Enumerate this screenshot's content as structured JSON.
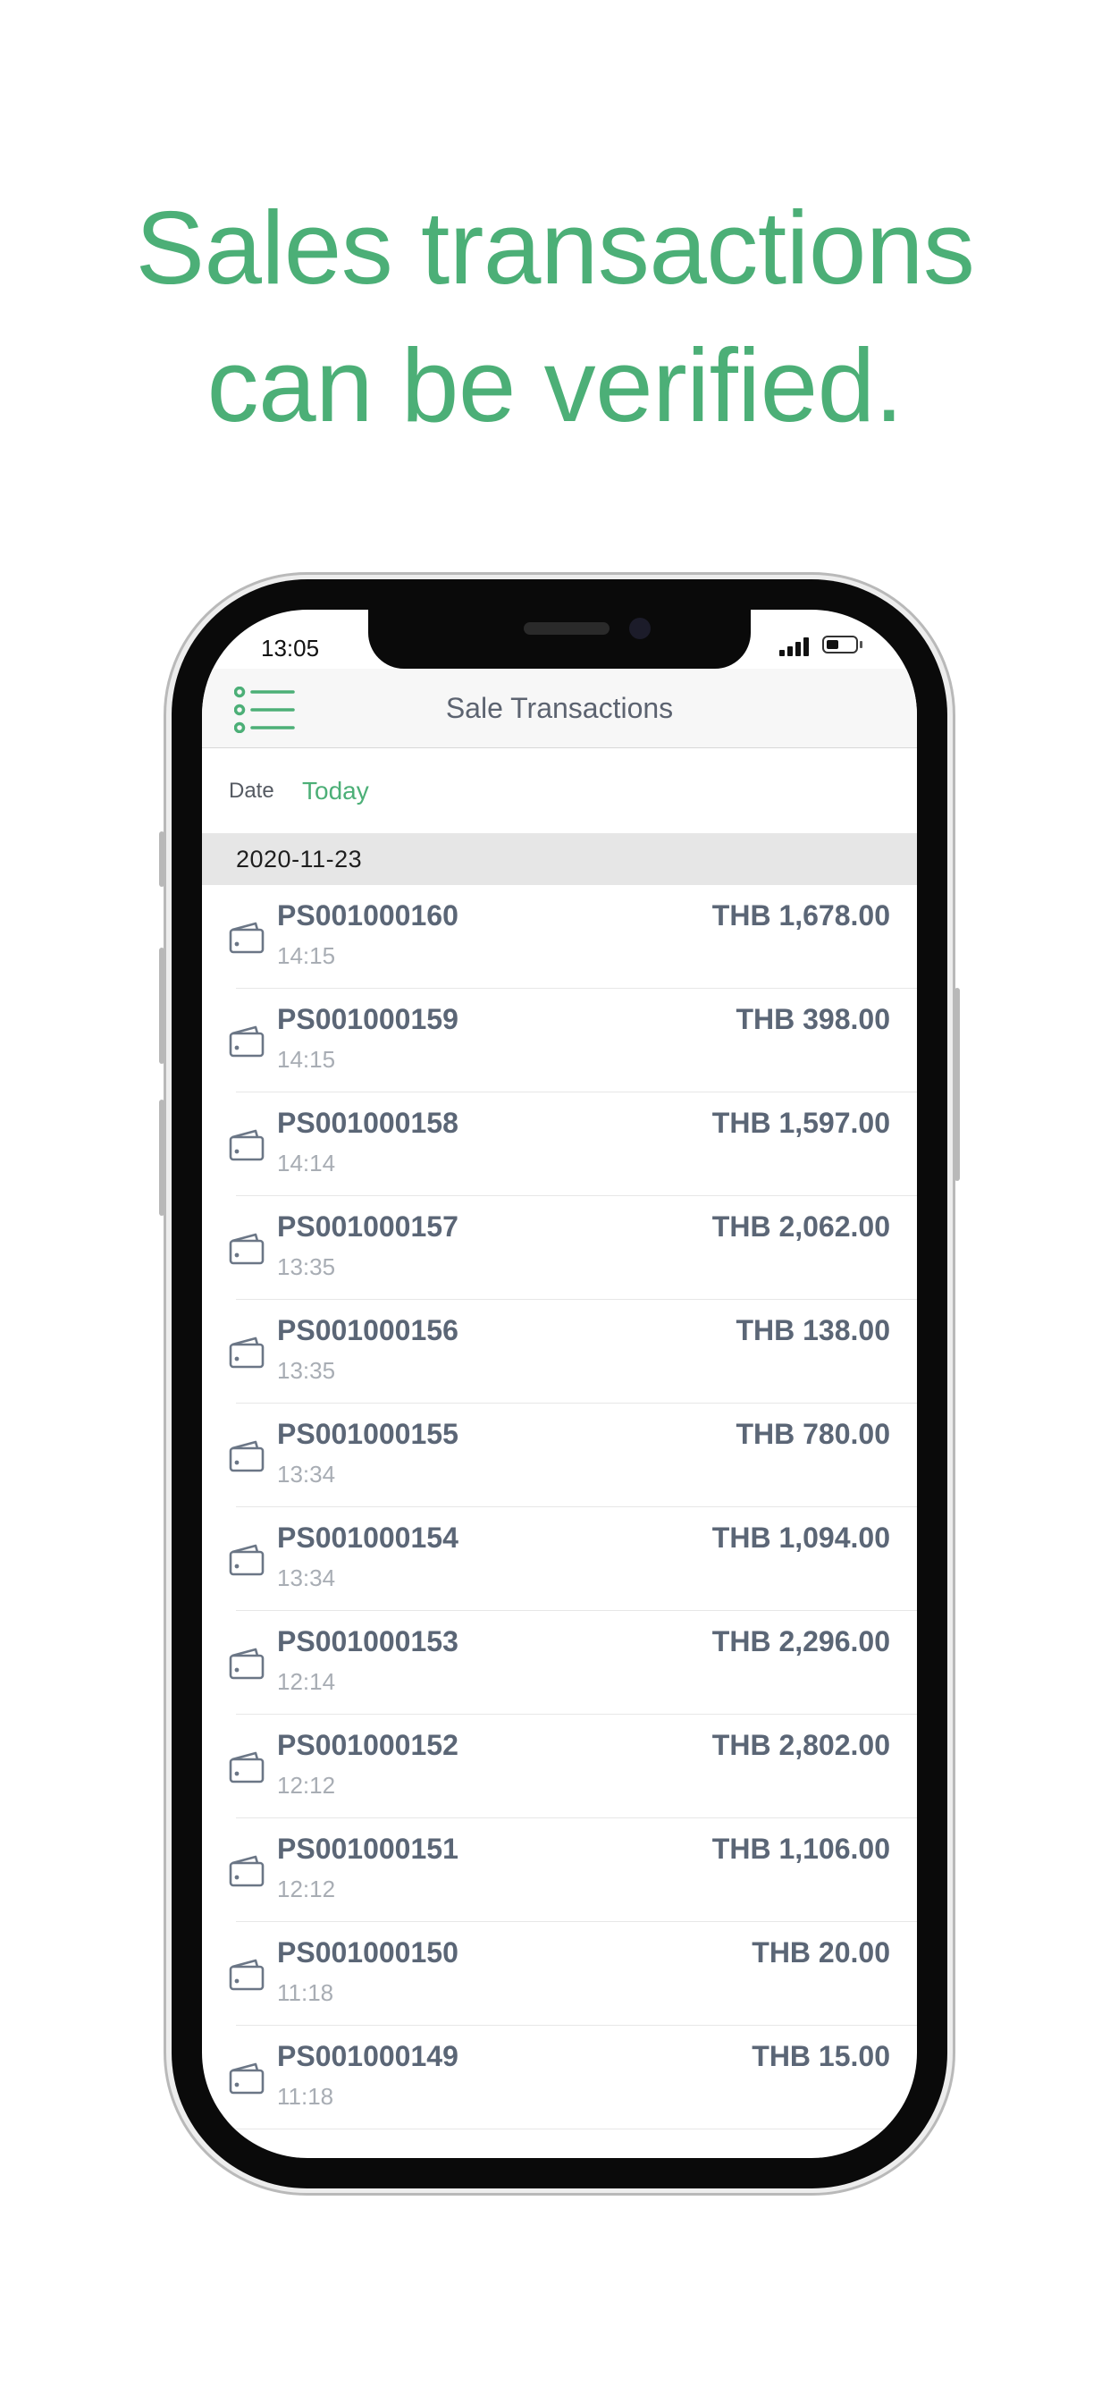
{
  "headline": {
    "line1": "Sales transactions",
    "line2": "can be verified."
  },
  "status_bar": {
    "time": "13:05"
  },
  "navbar": {
    "title": "Sale Transactions",
    "menu_icon": "list-menu-icon"
  },
  "filter": {
    "label": "Date",
    "value": "Today"
  },
  "section": {
    "date": "2020-11-23"
  },
  "transactions": [
    {
      "id": "PS001000160",
      "time": "14:15",
      "amount": "THB 1,678.00"
    },
    {
      "id": "PS001000159",
      "time": "14:15",
      "amount": "THB 398.00"
    },
    {
      "id": "PS001000158",
      "time": "14:14",
      "amount": "THB 1,597.00"
    },
    {
      "id": "PS001000157",
      "time": "13:35",
      "amount": "THB 2,062.00"
    },
    {
      "id": "PS001000156",
      "time": "13:35",
      "amount": "THB 138.00"
    },
    {
      "id": "PS001000155",
      "time": "13:34",
      "amount": "THB 780.00"
    },
    {
      "id": "PS001000154",
      "time": "13:34",
      "amount": "THB 1,094.00"
    },
    {
      "id": "PS001000153",
      "time": "12:14",
      "amount": "THB 2,296.00"
    },
    {
      "id": "PS001000152",
      "time": "12:12",
      "amount": "THB 2,802.00"
    },
    {
      "id": "PS001000151",
      "time": "12:12",
      "amount": "THB 1,106.00"
    },
    {
      "id": "PS001000150",
      "time": "11:18",
      "amount": "THB 20.00"
    },
    {
      "id": "PS001000149",
      "time": "11:18",
      "amount": "THB 15.00"
    }
  ],
  "colors": {
    "accent": "#4caf77",
    "text_primary": "#5b6676",
    "text_secondary": "#a8adb4"
  }
}
